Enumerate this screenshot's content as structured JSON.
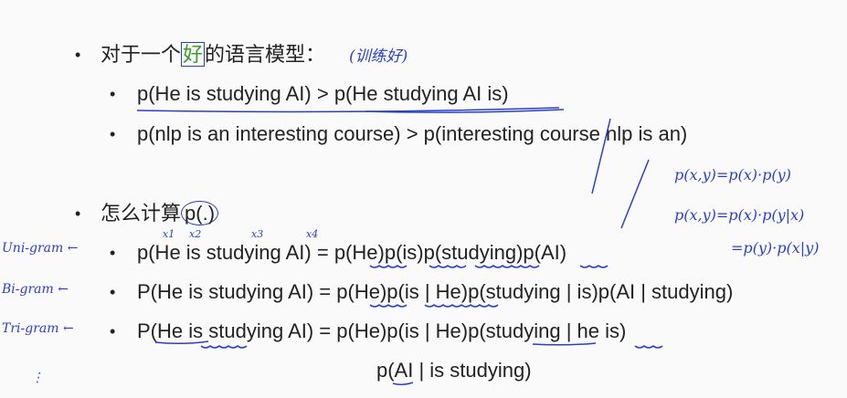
{
  "bullets": {
    "b1": {
      "prefix": "对于一个",
      "highlight": "好",
      "suffix": "的语言模型：",
      "note": "(训练好)"
    },
    "b1_sub": [
      "p(He is studying AI) > p(He studying AI is)",
      "p(nlp is an interesting course) > p(interesting course nlp is an)"
    ],
    "b2": {
      "prefix": "怎么计算",
      "circled": "p(.)"
    },
    "b2_sub": [
      "p(He is studying AI) = p(He)p(is)p(studying)p(AI)",
      "P(He is studying AI) = p(He)p(is | He)p(studying | is)p(AI | studying)",
      "P(He is studying AI) = p(He)p(is | He)p(studying | he is)",
      "p(AI | is studying)"
    ]
  },
  "annotations": {
    "labels": [
      "Uni-gram ←",
      "Bi-gram ←",
      "Tri-gram ←",
      "⋮"
    ],
    "word_marks": [
      "x1",
      "x2",
      "x3",
      "x4"
    ],
    "formulas": [
      "p(x,y)=p(x)·p(y)",
      "p(x,y)=p(x)·p(y|x)",
      "=p(y)·p(x|y)"
    ]
  },
  "colors": {
    "text": "#222222",
    "ink": "#2a3fc9",
    "highlight": "#3a9a2a",
    "background": "#fafafa"
  }
}
